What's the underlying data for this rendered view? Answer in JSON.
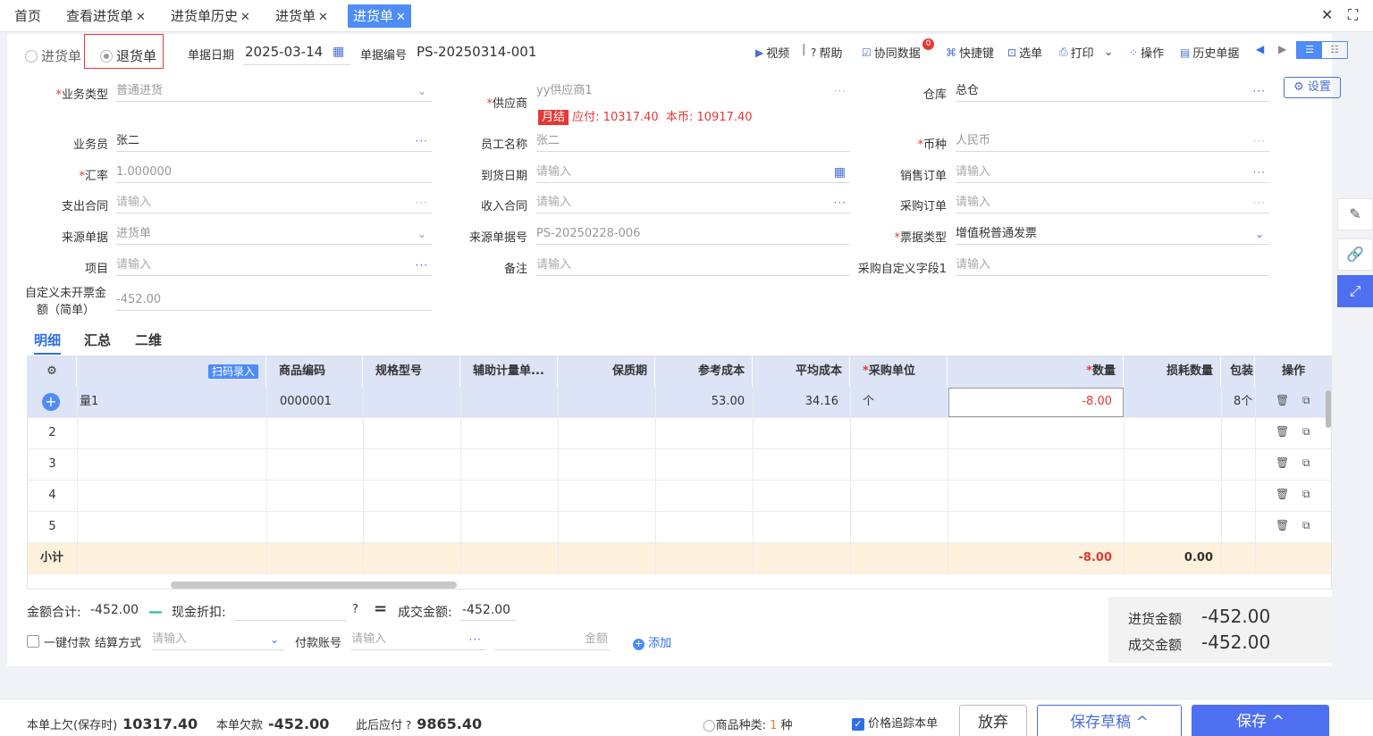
{
  "tabs": [
    {
      "label": "首页",
      "closable": false
    },
    {
      "label": "查看进货单",
      "closable": true
    },
    {
      "label": "进货单历史",
      "closable": true
    },
    {
      "label": "进货单",
      "closable": true
    },
    {
      "label": "进货单",
      "closable": true,
      "active": true
    }
  ],
  "window": {
    "close": "✕",
    "expand": "⛶"
  },
  "doc_type": {
    "option1": "进货单",
    "option2": "退货单",
    "selected": "退货单"
  },
  "header": {
    "date_label": "单据日期",
    "date_value": "2025-03-14",
    "number_label": "单据编号",
    "number_value": "PS-20250314-001"
  },
  "toolbar": {
    "video": "视频",
    "help": "帮助",
    "sync": "协同数据",
    "sync_badge": "0",
    "shortcut": "快捷键",
    "select": "选单",
    "print": "打印",
    "ops": "操作",
    "history": "历史单据"
  },
  "settings_label": "设置",
  "form": {
    "biz_type": {
      "label": "业务类型",
      "value": "普通进货"
    },
    "supplier": {
      "label": "供应商",
      "value": "yy供应商1",
      "tag": "月结",
      "payable": "应付: 10317.40",
      "base": "本币: 10917.40"
    },
    "warehouse": {
      "label": "仓库",
      "value": "总仓"
    },
    "salesman": {
      "label": "业务员",
      "value": "张二"
    },
    "employee": {
      "label": "员工名称",
      "value": "张二"
    },
    "currency": {
      "label": "币种",
      "value": "人民币"
    },
    "rate": {
      "label": "汇率",
      "value": "1.000000"
    },
    "arrival": {
      "label": "到货日期",
      "placeholder": "请输入"
    },
    "sales_order": {
      "label": "销售订单",
      "placeholder": "请输入"
    },
    "expense_contract": {
      "label": "支出合同",
      "placeholder": "请输入"
    },
    "income_contract": {
      "label": "收入合同",
      "placeholder": "请输入"
    },
    "purchase_order": {
      "label": "采购订单",
      "placeholder": "请输入"
    },
    "source_doc": {
      "label": "来源单据",
      "value": "进货单"
    },
    "source_no": {
      "label": "来源单据号",
      "value": "PS-20250228-006"
    },
    "invoice_type": {
      "label": "票据类型",
      "value": "增值税普通发票"
    },
    "project": {
      "label": "项目",
      "placeholder": "请输入"
    },
    "remark": {
      "label": "备注",
      "placeholder": "请输入"
    },
    "custom1": {
      "label": "采购自定义字段1",
      "placeholder": "请输入"
    },
    "uninvoiced": {
      "label1": "自定义未开票金",
      "label2": "额（简单）",
      "value": "-452.00"
    }
  },
  "subtabs": [
    "明细",
    "汇总",
    "二维"
  ],
  "grid": {
    "scan_label": "扫码录入",
    "columns": [
      "商品编码",
      "规格型号",
      "辅助计量单...",
      "保质期",
      "参考成本",
      "平均成本",
      "采购单位",
      "数量",
      "损耗数量",
      "包装",
      "操作"
    ],
    "row1": {
      "name": "量1",
      "code": "0000001",
      "ref_cost": "53.00",
      "avg_cost": "34.16",
      "unit": "个",
      "qty": "-8.00",
      "pack": "8个"
    },
    "row_numbers": [
      "2",
      "3",
      "4",
      "5"
    ],
    "subtotal_label": "小计",
    "subtotal_qty": "-8.00",
    "subtotal_loss": "0.00"
  },
  "totals": {
    "amount_label": "金额合计:",
    "amount_value": "-452.00",
    "discount_label": "现金折扣:",
    "deal_label": "成交金额:",
    "deal_value": "-452.00",
    "onekey_label": "一键付款",
    "settle_label": "结算方式",
    "settle_placeholder": "请输入",
    "account_label": "付款账号",
    "account_placeholder": "请输入",
    "money_placeholder": "金额",
    "add_label": "添加"
  },
  "summary": {
    "in_label": "进货金额",
    "in_value": "-452.00",
    "deal_label": "成交金额",
    "deal_value": "-452.00"
  },
  "footer": {
    "prev_owe_label": "本单上欠(保存时)",
    "prev_owe_value": "10317.40",
    "owe_label": "本单欠款",
    "owe_value": "-452.00",
    "after_label": "此后应付",
    "after_value": "9865.40",
    "kinds_label": "商品种类:",
    "kinds_value": "1",
    "kinds_unit": "种",
    "trace_label": "价格追踪本单",
    "discard": "放弃",
    "save_draft": "保存草稿",
    "save": "保存"
  }
}
